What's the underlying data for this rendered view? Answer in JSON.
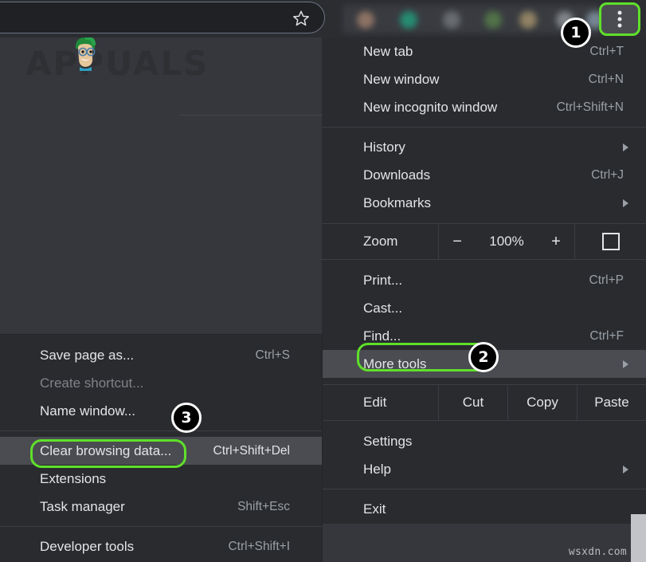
{
  "browser": {
    "omnibox_value": "",
    "star_icon": "bookmark-star-icon",
    "menu_button_icon": "three-dot-menu-icon"
  },
  "watermark": {
    "logo_text": "APPUALS",
    "corner_text": "wsxdn.com"
  },
  "main_menu": {
    "items": [
      {
        "label": "New tab",
        "shortcut": "Ctrl+T",
        "arrow": false
      },
      {
        "label": "New window",
        "shortcut": "Ctrl+N",
        "arrow": false
      },
      {
        "label": "New incognito window",
        "shortcut": "Ctrl+Shift+N",
        "arrow": false
      },
      {
        "label": "History",
        "shortcut": "",
        "arrow": true
      },
      {
        "label": "Downloads",
        "shortcut": "Ctrl+J",
        "arrow": false
      },
      {
        "label": "Bookmarks",
        "shortcut": "",
        "arrow": true
      },
      {
        "label": "Print...",
        "shortcut": "Ctrl+P",
        "arrow": false
      },
      {
        "label": "Cast...",
        "shortcut": "",
        "arrow": false
      },
      {
        "label": "Find...",
        "shortcut": "Ctrl+F",
        "arrow": false
      },
      {
        "label": "More tools",
        "shortcut": "",
        "arrow": true
      },
      {
        "label": "Settings",
        "shortcut": "",
        "arrow": false
      },
      {
        "label": "Help",
        "shortcut": "",
        "arrow": true
      },
      {
        "label": "Exit",
        "shortcut": "",
        "arrow": false
      }
    ],
    "zoom_row": {
      "label": "Zoom",
      "minus": "−",
      "value": "100%",
      "plus": "+",
      "fullscreen_icon": "fullscreen-icon"
    },
    "edit_row": {
      "label": "Edit",
      "cut": "Cut",
      "copy": "Copy",
      "paste": "Paste"
    }
  },
  "more_tools_submenu": {
    "items": [
      {
        "label": "Save page as...",
        "shortcut": "Ctrl+S",
        "disabled": false
      },
      {
        "label": "Create shortcut...",
        "shortcut": "",
        "disabled": true
      },
      {
        "label": "Name window...",
        "shortcut": "",
        "disabled": false
      },
      {
        "label": "Clear browsing data...",
        "shortcut": "Ctrl+Shift+Del",
        "disabled": false
      },
      {
        "label": "Extensions",
        "shortcut": "",
        "disabled": false
      },
      {
        "label": "Task manager",
        "shortcut": "Shift+Esc",
        "disabled": false
      },
      {
        "label": "Developer tools",
        "shortcut": "Ctrl+Shift+I",
        "disabled": false
      }
    ]
  },
  "annotations": {
    "highlight_color": "#5fe02a",
    "badges": [
      {
        "number": "1",
        "target": "three-dot-menu-button"
      },
      {
        "number": "2",
        "target": "more-tools-menu-item"
      },
      {
        "number": "3",
        "target": "clear-browsing-data-menu-item"
      }
    ]
  }
}
